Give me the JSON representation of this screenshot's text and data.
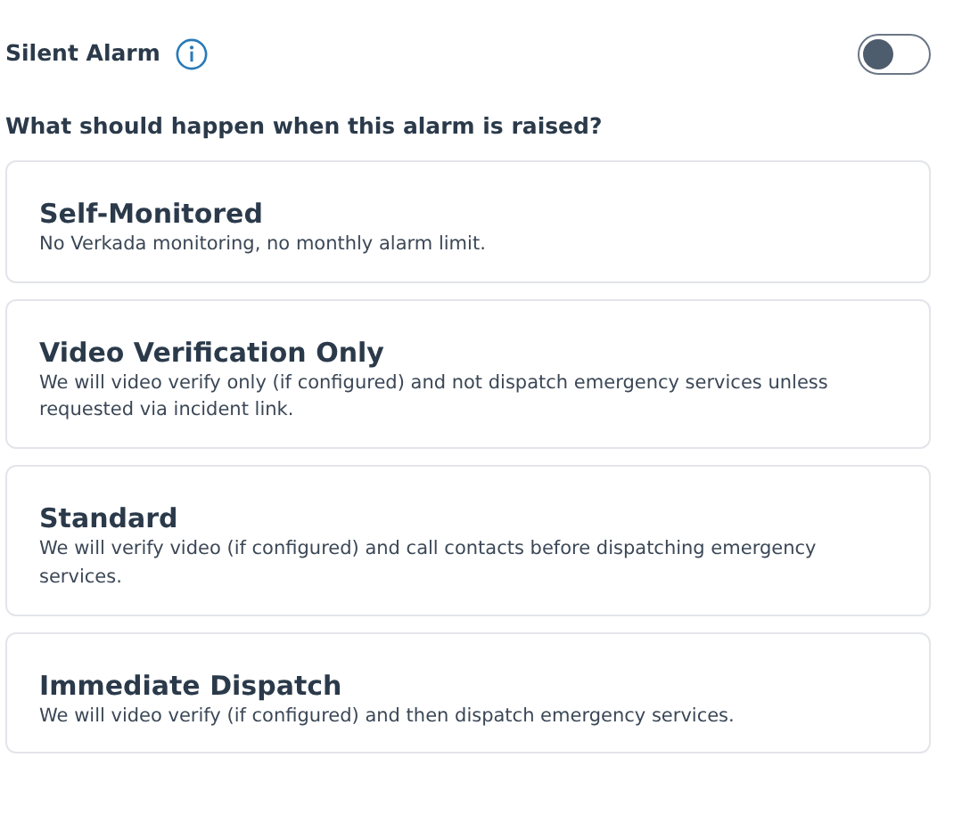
{
  "silent_alarm": {
    "label": "Silent Alarm",
    "on": false
  },
  "question": "What should happen when this alarm is raised?",
  "options": [
    {
      "title": "Self-Monitored",
      "description": "No Verkada monitoring, no monthly alarm limit."
    },
    {
      "title": "Video Verification Only",
      "description": "We will video verify only (if configured) and not dispatch emergency services unless requested via incident link."
    },
    {
      "title": "Standard",
      "description": "We will verify video (if configured) and call contacts before dispatching emergency services."
    },
    {
      "title": "Immediate Dispatch",
      "description": "We will video verify (if configured) and then dispatch emergency services."
    }
  ]
}
